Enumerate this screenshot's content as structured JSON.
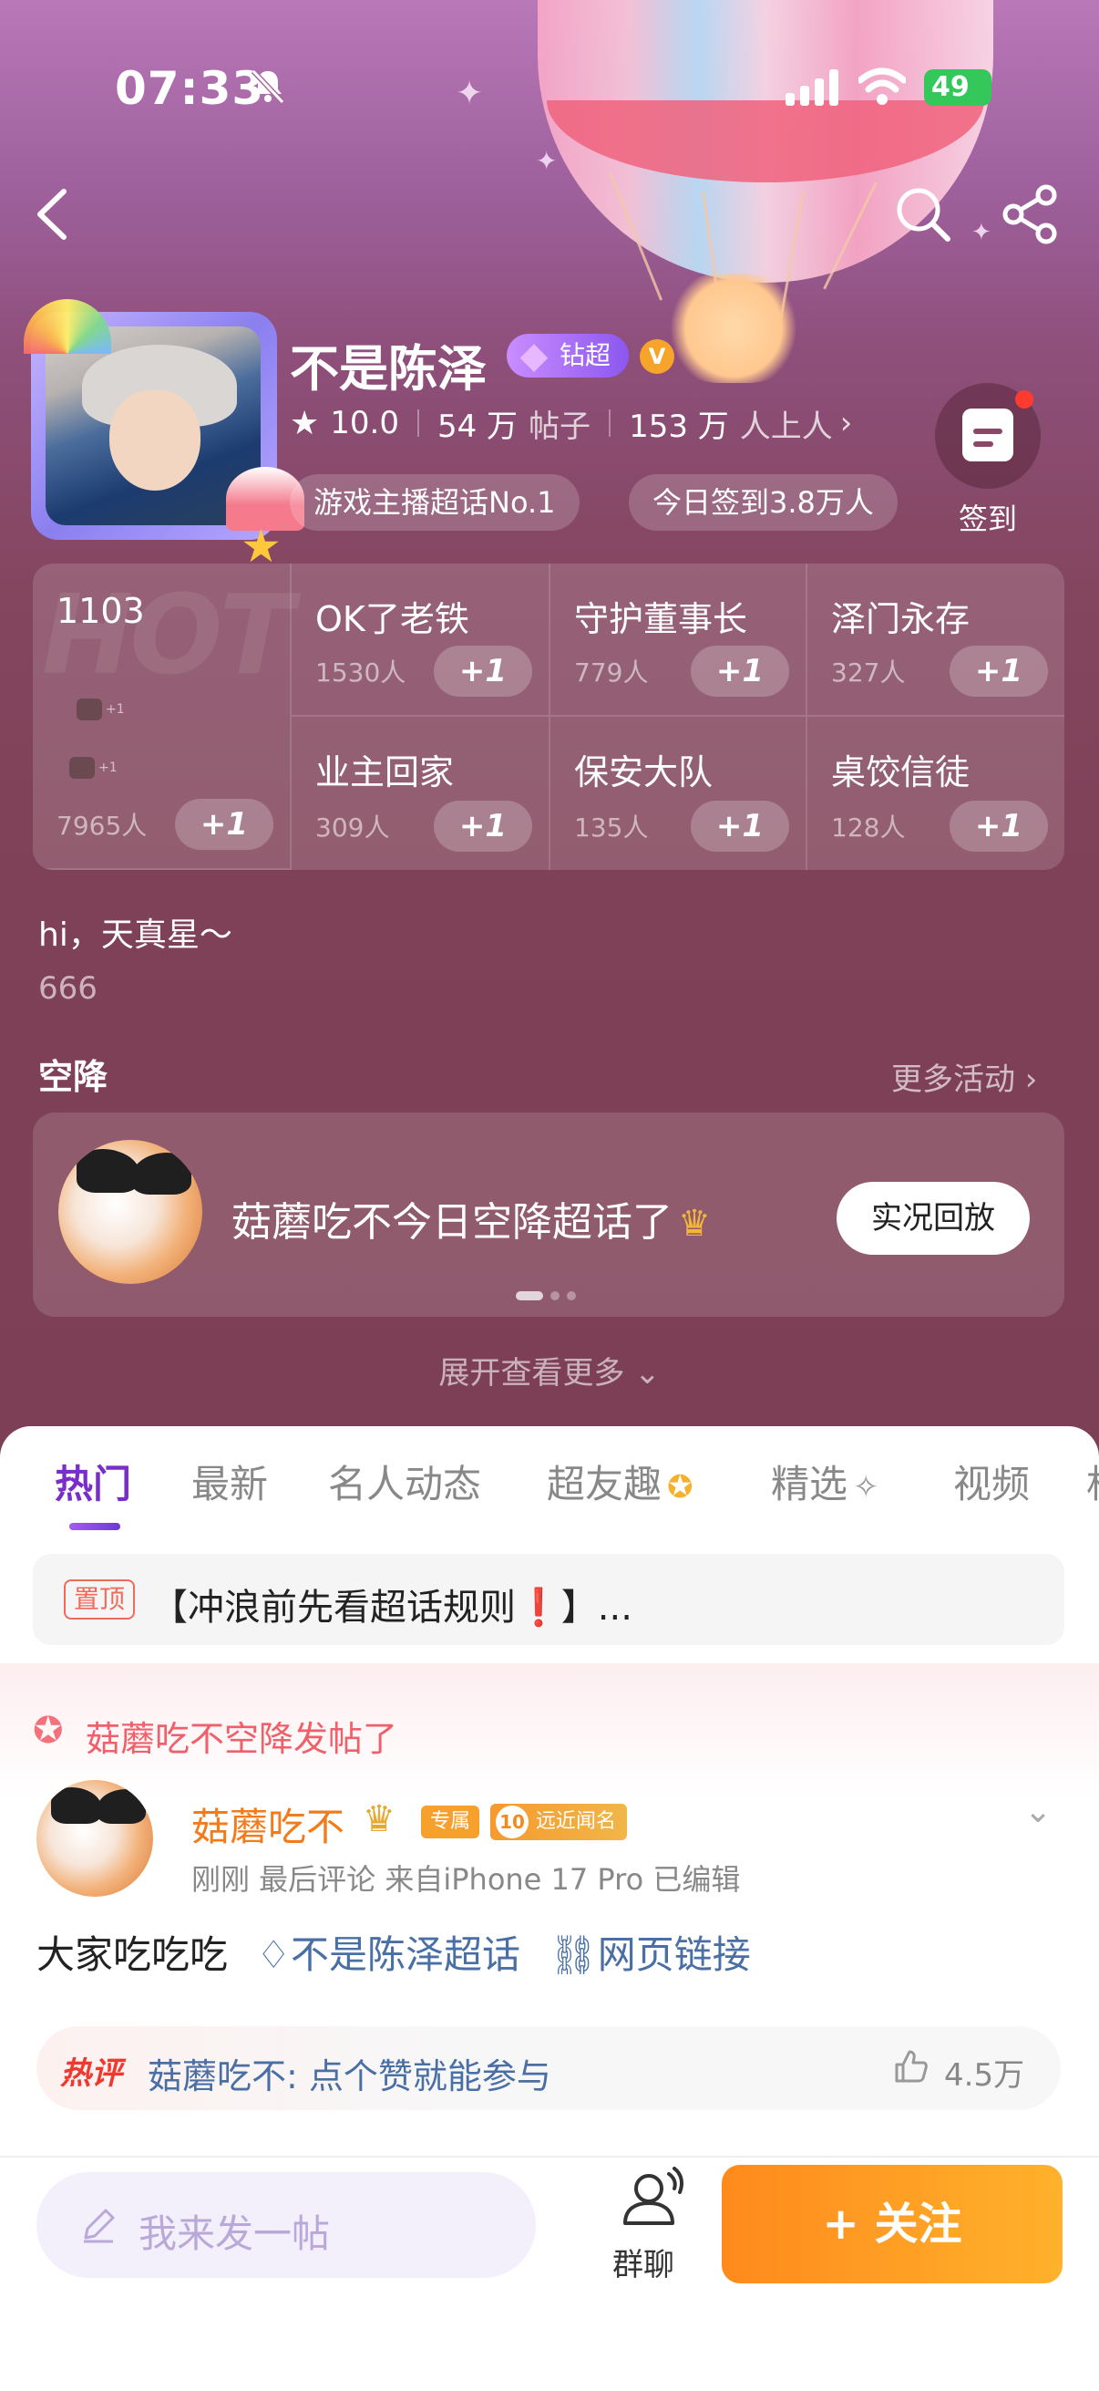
{
  "status_bar": {
    "time": "07:33",
    "battery": "49"
  },
  "topic": {
    "title": "不是陈泽",
    "diamond_badge": "钻超",
    "verified": "V",
    "rating": "10.0",
    "posts_num": "54 万",
    "posts_unit": "帖子",
    "people_num": "153 万",
    "people_unit": "人上人",
    "tag_rank": "游戏主播超话No.1",
    "tag_checkin": "今日签到3.8万人",
    "checkin_label": "签到"
  },
  "groups": {
    "main": {
      "name": "1103",
      "count": "7965人"
    },
    "items": [
      {
        "name": "OK了老铁",
        "count": "1530人"
      },
      {
        "name": "守护董事长",
        "count": "779人"
      },
      {
        "name": "泽门永存",
        "count": "327人"
      },
      {
        "name": "业主回家",
        "count": "309人"
      },
      {
        "name": "保安大队",
        "count": "135人"
      },
      {
        "name": "桌饺信徒",
        "count": "128人"
      }
    ],
    "plus_label": "+1",
    "watermark": "HOT",
    "mini_plus": "+1"
  },
  "greeting": {
    "line1": "hi，天真星～",
    "line2": "666"
  },
  "airdrop": {
    "title": "空降",
    "more": "更多活动 ›",
    "text": "菇蘑吃不今日空降超话了",
    "replay": "实况回放"
  },
  "expand_more": "展开查看更多 ⌄",
  "tabs": [
    {
      "label": "热门"
    },
    {
      "label": "最新"
    },
    {
      "label": "名人动态"
    },
    {
      "label": "超友趣"
    },
    {
      "label": "精选"
    },
    {
      "label": "视频"
    },
    {
      "label": "相"
    }
  ],
  "pinned": {
    "tag": "置顶",
    "text": "【冲浪前先看超话规则❗】..."
  },
  "airdrop_post_label": "菇蘑吃不空降发帖了",
  "post": {
    "author": "菇蘑吃不",
    "exclusive": "专属",
    "fame_level": "10",
    "fame": "远近闻名",
    "meta": "刚刚  最后评论   来自iPhone 17 Pro  已编辑",
    "body": "大家吃吃吃",
    "link1": "不是陈泽超话",
    "link2": "网页链接",
    "hot_tag": "热评",
    "hot_comment": "菇蘑吃不: 点个赞就能参与",
    "likes": "4.5万"
  },
  "bottom_bar": {
    "placeholder": "我来发一帖",
    "group_chat": "群聊",
    "follow": "+ 关注"
  }
}
